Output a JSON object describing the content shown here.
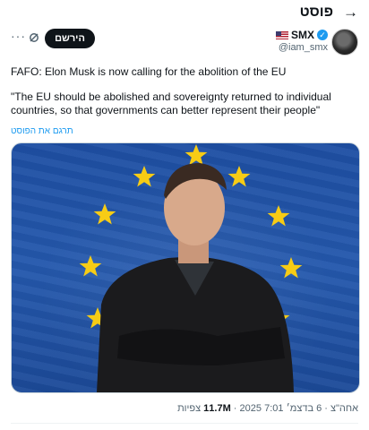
{
  "topbar": {
    "title": "פוסט",
    "back_icon": "arrow-right-icon"
  },
  "author": {
    "name": "SMX",
    "handle": "@iam_smx",
    "flag": "us-flag-icon",
    "verified_icon": "verified-badge-icon"
  },
  "actions": {
    "follow_label": "הירשם",
    "grok_icon": "grok-icon",
    "more_icon": "more-icon",
    "more_glyph": "···"
  },
  "post": {
    "line1": "FAFO: Elon Musk is now calling for the abolition of the EU",
    "quote": "\"The EU should be abolished and sovereignty returned to individual countries, so that governments can better represent their people\"",
    "translate_label": "תרגם את הפוסט"
  },
  "meta": {
    "time": "7:01 2025",
    "date": "אחה\"צ · 6 בדצמ׳",
    "views_count": "11.7M",
    "views_label": "צפיות"
  },
  "colors": {
    "accent": "#1d9bf0",
    "flag_blue": "#2458ad",
    "star_yellow": "#f7cc15"
  }
}
